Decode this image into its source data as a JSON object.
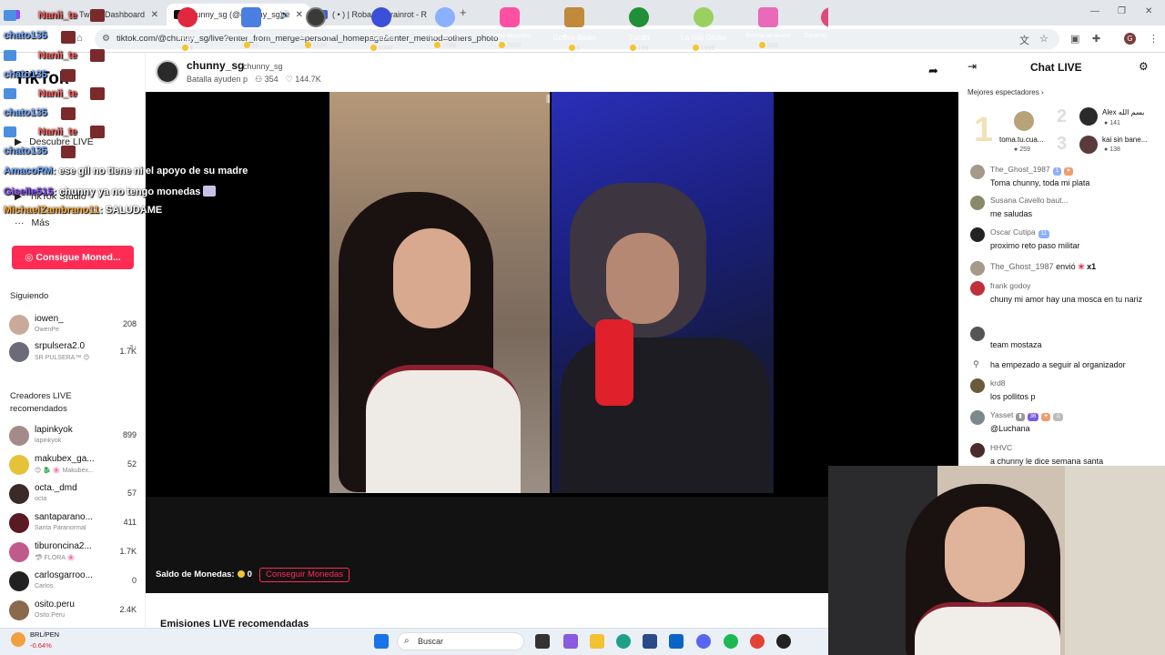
{
  "browser": {
    "tabs": [
      {
        "label": "Twitch Dashboard",
        "active": false
      },
      {
        "label": "chunny_sg (@chunny_sg) e",
        "active": true
      },
      {
        "label": "( • ) | Roba un Brainrot - R",
        "active": false
      }
    ],
    "url": "tiktok.com/@chunny_sg/live?enter_from_merge=personal_homepage&enter_method=others_photo"
  },
  "sidebar": {
    "logo": "TikTok",
    "nav": [
      {
        "label": "Descubre LIVE",
        "icon": "live-icon"
      },
      {
        "label": "TikTok Studio",
        "icon": "studio-icon"
      },
      {
        "label": "Más",
        "icon": "more-icon"
      }
    ],
    "get_coins": "Consigue Moned...",
    "following_title": "Siguiendo",
    "following": [
      {
        "name": "iowen_",
        "sub": "OwenPe",
        "count": "208"
      },
      {
        "name": "srpulsera2.0",
        "sub": "SR PULSERA™ 😊",
        "count": "1.7K"
      }
    ],
    "creators_title": "Creadores LIVE recomendados",
    "creators": [
      {
        "name": "lapinkyok",
        "sub": "lapinkyok",
        "count": "899"
      },
      {
        "name": "makubex_ga...",
        "sub": "😊 🐉 🌸 Makubex...",
        "count": "52"
      },
      {
        "name": "octa._dmd",
        "sub": "octa",
        "count": "57"
      },
      {
        "name": "santaparano...",
        "sub": "Santa Paranormal",
        "count": "411"
      },
      {
        "name": "tiburoncina2...",
        "sub": "🦈 FLORA 🌸",
        "count": "1.7K"
      },
      {
        "name": "carlosgarroo...",
        "sub": "Carlos",
        "count": "0"
      },
      {
        "name": "osito.peru",
        "sub": "Osito.Peru",
        "count": "2.4K"
      }
    ]
  },
  "stream": {
    "name": "chunny_sg",
    "handle": "chunny_sg",
    "title": "Batalla ayuden p",
    "viewers": "354",
    "likes": "144.7K"
  },
  "gifts": [
    {
      "name": "Rosa",
      "price": "1",
      "color": "#e0283e"
    },
    {
      "name": "Paso para el ove...",
      "price": "10",
      "color": "#4a7fe0"
    },
    {
      "name": "Debut en las carr...",
      "price": "1500",
      "color": "#3a3a3a"
    },
    {
      "name": "Galaxia",
      "price": "1000",
      "color": "#3b4fd8"
    },
    {
      "name": "Fuegos artificiales",
      "price": "1088",
      "color": "#8ab0ff"
    },
    {
      "name": "Coche deportivo",
      "price": "7000",
      "color": "#ff4fa3"
    },
    {
      "name": "Coffee Bean",
      "price": "5",
      "color": "#c08a3a"
    },
    {
      "name": "Tucán",
      "price": "199",
      "color": "#1f8f3a"
    },
    {
      "name": "La Isla Globo",
      "price": "1999",
      "color": "#9ad060"
    },
    {
      "name": "Pistola de dinero",
      "price": "500",
      "color": "#e86ab8"
    },
    {
      "name": "Corazón",
      "price": "",
      "color": "#e04a7a"
    }
  ],
  "wallet": {
    "label": "Saldo de Monedas:",
    "amount": "0",
    "button": "Conseguir Monedas"
  },
  "recommended_title": "Emisiones LIVE recomendadas",
  "chat": {
    "title": "Chat LIVE",
    "top_title": "Mejores espectadores",
    "top": [
      {
        "rank": "1",
        "name": "toma.tu.cua...",
        "score": "259"
      },
      {
        "rank": "2",
        "name": "Alex بسم الله",
        "score": "141"
      },
      {
        "rank": "3",
        "name": "kai sin bane...",
        "score": "138"
      }
    ],
    "messages": [
      {
        "user": "The_Ghost_1987",
        "text": "Toma chunny, toda mi plata"
      },
      {
        "user": "Susana Cavello baut...",
        "text": "me saludas"
      },
      {
        "user": "Oscar Cutipa",
        "text": "proximo reto paso militar"
      },
      {
        "user": "The_Ghost_1987",
        "text": "envió",
        "suffix": "x1"
      },
      {
        "user": "frank godoy",
        "text": "chuny mi amor hay una mosca en tu nariz"
      },
      {
        "user": "",
        "text": "team mostaza"
      },
      {
        "user": "",
        "text": "ha empezado a seguir al organizador"
      },
      {
        "user": "krd8",
        "text": "los pollitos p"
      },
      {
        "user": "Yasset",
        "text": "@Luchana"
      },
      {
        "user": "HHVC",
        "text": "a chunny le dice semana santa"
      }
    ],
    "badge_11": "11",
    "badge_36": "36"
  },
  "overlay_chat": [
    {
      "user": "Nanii_te",
      "text": ""
    },
    {
      "user": "chato135",
      "text": ""
    },
    {
      "user": "Nanii_te",
      "text": ""
    },
    {
      "user": "chato135",
      "text": ""
    },
    {
      "user": "Nanii_te",
      "text": ""
    },
    {
      "user": "chato135",
      "text": ""
    },
    {
      "user": "Nanii_te",
      "text": ""
    },
    {
      "user": "chato135",
      "text": ""
    },
    {
      "user": "AmacoRM",
      "text": ": ese gil no tiene ni el apoyo de su madre"
    },
    {
      "user": "Giselle515",
      "text": ": chunny ya no tengo monedas"
    },
    {
      "user": "MichaelZambrano11",
      "text": ": SALUDAME"
    }
  ],
  "taskbar": {
    "ticker_label": "BRL/PEN",
    "ticker_value": "-0.64%",
    "search": "Buscar"
  }
}
